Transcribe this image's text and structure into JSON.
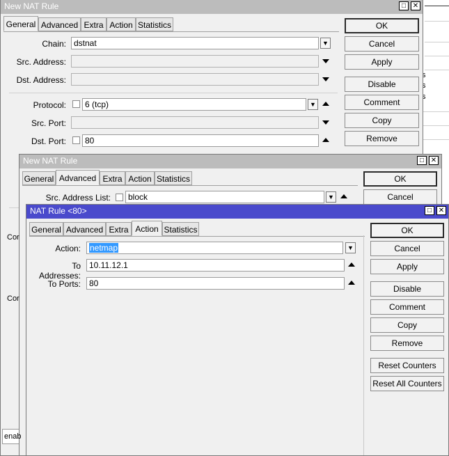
{
  "window1": {
    "title": "New NAT Rule",
    "tabs": [
      "General",
      "Advanced",
      "Extra",
      "Action",
      "Statistics"
    ],
    "fields": {
      "chain_label": "Chain:",
      "chain_value": "dstnat",
      "src_address_label": "Src. Address:",
      "dst_address_label": "Dst. Address:",
      "protocol_label": "Protocol:",
      "protocol_value": "6 (tcp)",
      "src_port_label": "Src. Port:",
      "dst_port_label": "Dst. Port:",
      "dst_port_value": "80"
    },
    "buttons": [
      "OK",
      "Cancel",
      "Apply",
      "Disable",
      "Comment",
      "Copy",
      "Remove"
    ]
  },
  "window2": {
    "title": "New NAT Rule",
    "tabs": [
      "General",
      "Advanced",
      "Extra",
      "Action",
      "Statistics"
    ],
    "fields": {
      "src_address_list_label": "Src. Address List:",
      "src_address_list_value": "block"
    },
    "buttons": [
      "OK",
      "Cancel"
    ]
  },
  "window3": {
    "title": "NAT Rule <80>",
    "tabs": [
      "General",
      "Advanced",
      "Extra",
      "Action",
      "Statistics"
    ],
    "fields": {
      "action_label": "Action:",
      "action_value": "netmap",
      "to_addresses_label": "To Addresses:",
      "to_addresses_value": "10.11.12.1",
      "to_ports_label": "To Ports:",
      "to_ports_value": "80"
    },
    "buttons": [
      "OK",
      "Cancel",
      "Apply",
      "Disable",
      "Comment",
      "Copy",
      "Remove",
      "Reset Counters",
      "Reset All Counters"
    ]
  },
  "background": {
    "text_s1": "s",
    "text_s2": "s",
    "text_s3": "s",
    "text_con1": "Cor",
    "text_con2": "Cor",
    "text_enab": "enab"
  },
  "colors": {
    "active_titlebar": "#4a4acc",
    "inactive_titlebar": "#bcbcbc",
    "selection": "#3399ff"
  }
}
